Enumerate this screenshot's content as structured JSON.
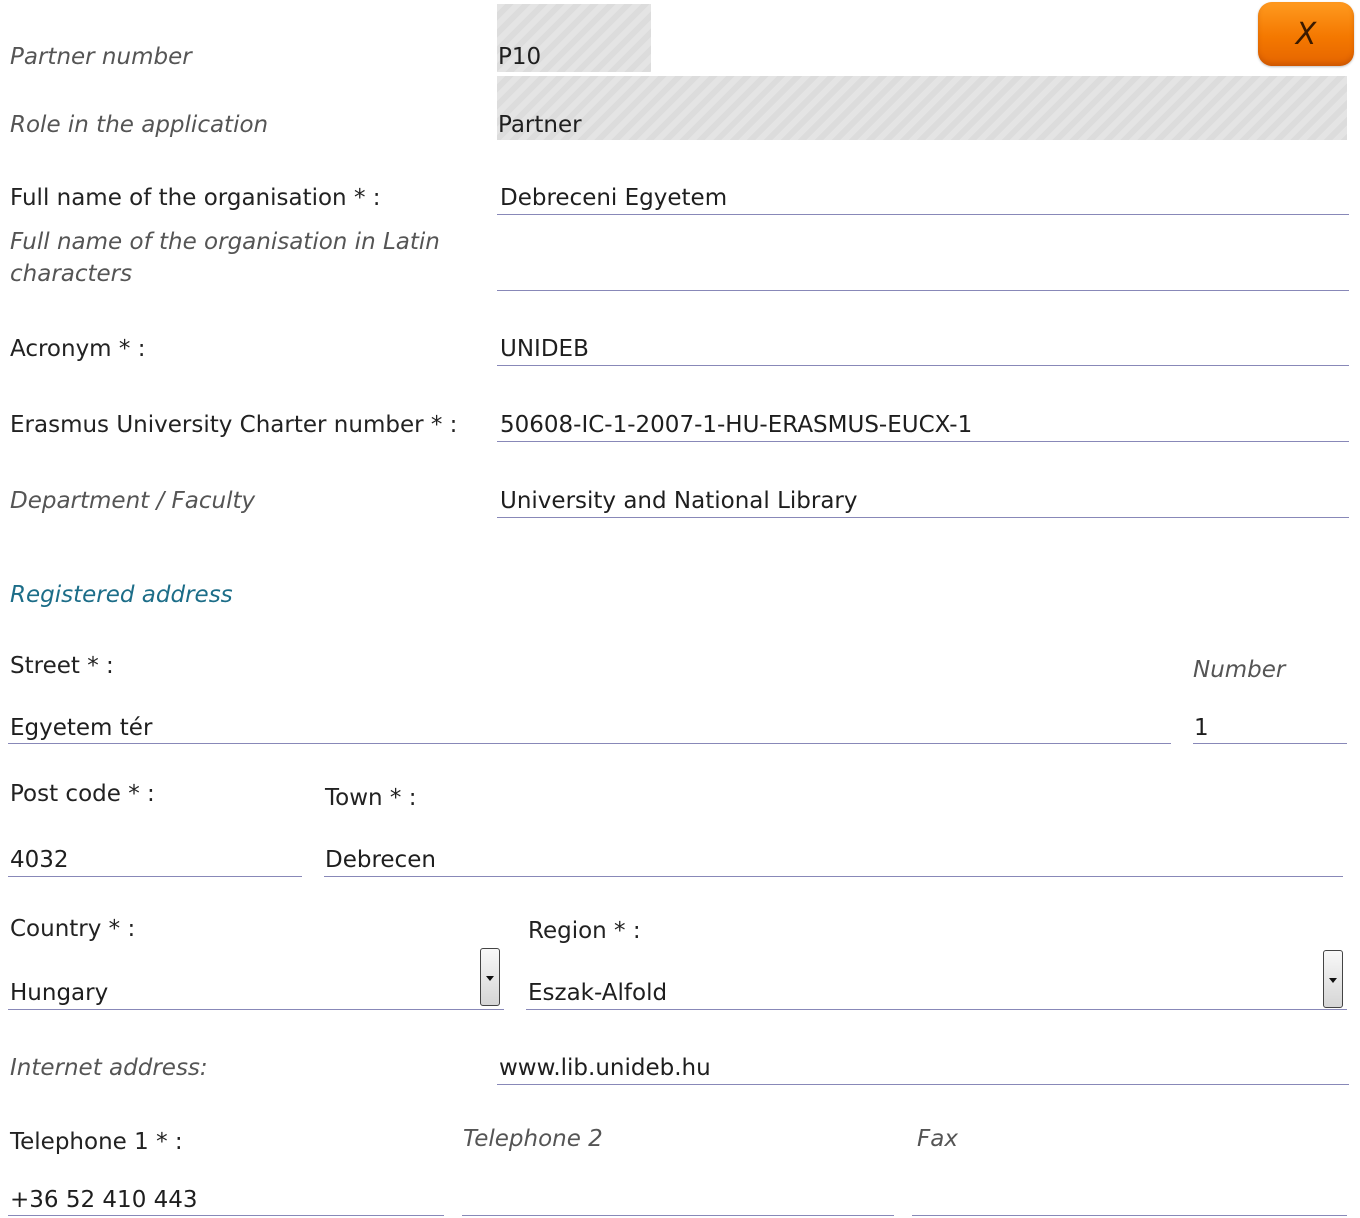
{
  "close_button": {
    "label": "X"
  },
  "partner": {
    "partner_number": {
      "label": "Partner number",
      "value": "P10"
    },
    "role": {
      "label": "Role in the application",
      "value": "Partner"
    }
  },
  "organisation": {
    "full_name": {
      "label": "Full name of the organisation * :",
      "value": "Debreceni Egyetem"
    },
    "full_name_latin": {
      "label": "Full name of the organisation in Latin characters",
      "value": ""
    },
    "acronym": {
      "label": "Acronym * :",
      "value": "UNIDEB"
    },
    "charter_number": {
      "label": "Erasmus University Charter number * :",
      "value": "50608-IC-1-2007-1-HU-ERASMUS-EUCX-1"
    },
    "department": {
      "label": "Department / Faculty",
      "value": "University and National Library"
    }
  },
  "registered_address": {
    "section_title": "Registered address",
    "street": {
      "label": "Street * :",
      "value": "Egyetem tér"
    },
    "number": {
      "label": "Number",
      "value": "1"
    },
    "post_code": {
      "label": "Post code * :",
      "value": "4032"
    },
    "town": {
      "label": "Town * :",
      "value": "Debrecen"
    },
    "country": {
      "label": "Country * :",
      "value": "Hungary"
    },
    "region": {
      "label": "Region * :",
      "value": "Eszak-Alfold"
    },
    "internet_address": {
      "label": "Internet address:",
      "value": "www.lib.unideb.hu"
    },
    "telephone1": {
      "label": "Telephone 1 * :",
      "value": "+36 52 410 443"
    },
    "telephone2": {
      "label": "Telephone 2",
      "value": ""
    },
    "fax": {
      "label": "Fax",
      "value": ""
    }
  },
  "colors": {
    "accent_orange": "#f47800",
    "section_title": "#1c6d88",
    "field_underline": "#8888b8",
    "readonly_fill": "#e0e0e0"
  }
}
